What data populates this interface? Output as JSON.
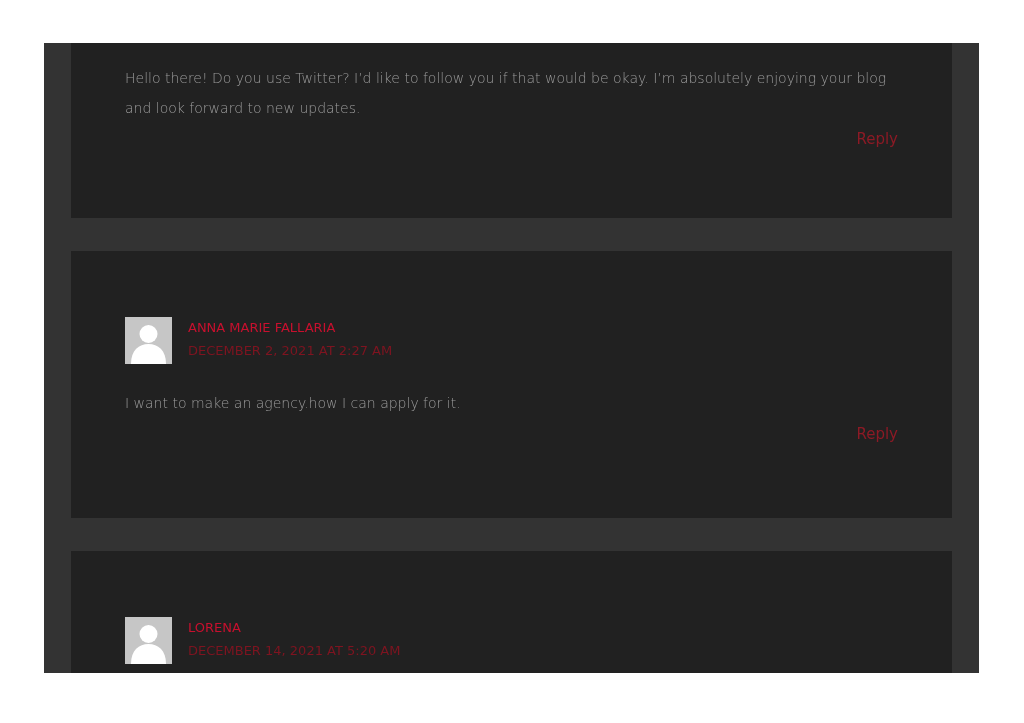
{
  "comments": [
    {
      "text": "Hello there! Do you use Twitter? I’d like to follow you if that would be okay. I’m absolutely enjoying your blog and look forward to new updates.",
      "reply": "Reply"
    },
    {
      "author": "ANNA MARIE FALLARIA",
      "date": "DECEMBER 2, 2021 AT 2:27 AM",
      "text": "I want to make an agency.how I can apply for it.",
      "reply": "Reply"
    },
    {
      "author": "LORENA",
      "date": "DECEMBER 14, 2021 AT 5:20 AM"
    }
  ]
}
